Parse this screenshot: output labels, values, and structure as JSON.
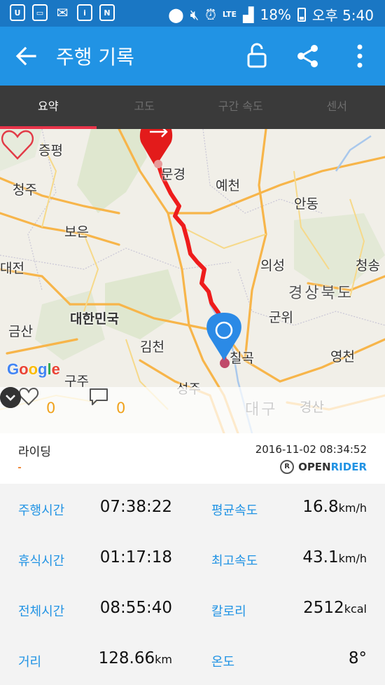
{
  "status_bar": {
    "lte": "LTE",
    "battery": "18%",
    "time": "오후 5:40"
  },
  "app_bar": {
    "title": "주행 기록"
  },
  "tabs": [
    {
      "label": "요약",
      "active": true
    },
    {
      "label": "고도",
      "active": false
    },
    {
      "label": "구간 속도",
      "active": false
    },
    {
      "label": "센서",
      "active": false
    }
  ],
  "map": {
    "places": [
      "증평",
      "청주",
      "보은",
      "대전",
      "금산",
      "대한민국",
      "김천",
      "구주",
      "성주",
      "문경",
      "예천",
      "안동",
      "의성",
      "청송",
      "경상북도",
      "군위",
      "칠곡",
      "영천",
      "대구",
      "경산"
    ],
    "attribution": "Google"
  },
  "social": {
    "likes": "0",
    "comments": "0"
  },
  "ride": {
    "name": "라이딩",
    "date": "2016-11-02 08:34:52",
    "brand_open": "OPEN",
    "brand_rider": "RIDER",
    "brand_mark": "R"
  },
  "stats": [
    {
      "label_left": "주행시간",
      "value_left": "07:38:22",
      "unit_left": "",
      "label_right": "평균속도",
      "value_right": "16.8",
      "unit_right": "km/h"
    },
    {
      "label_left": "휴식시간",
      "value_left": "01:17:18",
      "unit_left": "",
      "label_right": "최고속도",
      "value_right": "43.1",
      "unit_right": "km/h"
    },
    {
      "label_left": "전체시간",
      "value_left": "08:55:40",
      "unit_left": "",
      "label_right": "칼로리",
      "value_right": "2512",
      "unit_right": "kcal"
    },
    {
      "label_left": "거리",
      "value_left": "128.66",
      "unit_left": "km",
      "label_right": "온도",
      "value_right": "8°",
      "unit_right": ""
    }
  ],
  "colors": {
    "appbar": "#2193e4",
    "statusbar": "#1a77c4",
    "tab_bg": "#3a3a3a",
    "tab_indicator": "#e8344a",
    "route": "#ee1c1c",
    "label_blue": "#2193e4",
    "count_orange": "#f0a21c"
  }
}
